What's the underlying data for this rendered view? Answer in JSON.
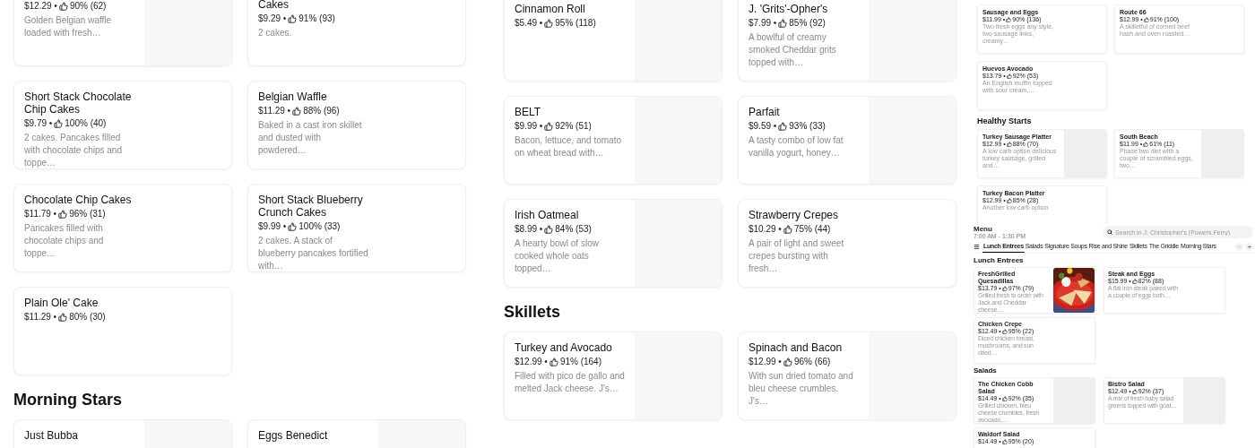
{
  "left_column": {
    "sections": [
      {
        "items": [
          {
            "kind": "with_image",
            "price": "$12.29 •",
            "rating": "90% (62)",
            "description": "Golden Belgian waffle loaded with fresh…"
          },
          {
            "kind": "text_only",
            "title": "Cakes",
            "price": "$9.29 •",
            "rating": "91% (93)",
            "description": "2 cakes."
          },
          {
            "kind": "text_only",
            "title": "Short Stack Chocolate Chip Cakes",
            "price": "$9.79 •",
            "rating": "100% (40)",
            "description": "2 cakes. Pancakes filled with chocolate chips and toppe…"
          },
          {
            "kind": "text_only",
            "title": "Belgian Waffle",
            "price": "$11.29 •",
            "rating": "88% (96)",
            "description": "Baked in a cast iron skillet and dusted with powdered…"
          },
          {
            "kind": "text_only",
            "title": "Chocolate Chip Cakes",
            "price": "$11.79 •",
            "rating": "96% (31)",
            "description": "Pancakes filled with chocolate chips and toppe…"
          },
          {
            "kind": "text_only",
            "title": "Short Stack Blueberry Crunch Cakes",
            "price": "$9.99 •",
            "rating": "100% (33)",
            "description": "2 cakes. A stack of blueberry pancakes fortified with…"
          },
          {
            "kind": "text_only",
            "title": "Plain Ole' Cake",
            "price": "$11.29 •",
            "rating": "80% (30)"
          }
        ]
      },
      {
        "heading": "Morning Stars",
        "items": [
          {
            "kind": "with_image",
            "title": "Just Bubba"
          },
          {
            "kind": "with_image",
            "title": "Eggs Benedict"
          }
        ]
      }
    ]
  },
  "middle_column": {
    "sections": [
      {
        "items": [
          {
            "kind": "with_image",
            "title": "Cinnamon Roll",
            "price": "$5.49 •",
            "rating": "95% (118)"
          },
          {
            "kind": "with_image",
            "title": "J. 'Grits'-Opher's",
            "price": "$7.99 •",
            "rating": "85% (92)",
            "description": "A bowlful of creamy smoked Cheddar grits topped with…"
          },
          {
            "kind": "with_image",
            "title": "BELT",
            "price": "$9.99 •",
            "rating": "92% (51)",
            "description": "Bacon, lettuce, and tomato on wheat bread with…"
          },
          {
            "kind": "with_image",
            "title": "Parfait",
            "price": "$9.59 •",
            "rating": "93% (33)",
            "description": "A tasty combo of low fat vanilla yogurt, honey…"
          },
          {
            "kind": "with_image",
            "title": "Irish Oatmeal",
            "price": "$8.99 •",
            "rating": "84% (53)",
            "description": "A hearty bowl of slow cooked whole oats topped…"
          },
          {
            "kind": "text_only",
            "title": "Strawberry Crepes",
            "price": "$10.29 •",
            "rating": "75% (44)",
            "description": "A pair of light and sweet crepes bursting with fresh…"
          }
        ]
      },
      {
        "heading": "Skillets",
        "items": [
          {
            "kind": "with_image",
            "title": "Turkey and Avocado",
            "price": "$12.99 •",
            "rating": "91% (164)",
            "description": "Filled with pico de gallo and melted Jack cheese. J's…"
          },
          {
            "kind": "with_image",
            "title": "Spinach and Bacon",
            "price": "$12.99 •",
            "rating": "96% (66)",
            "description": "With sun dried tomato and bleu cheese crumbles. J's…"
          }
        ]
      }
    ]
  },
  "right_column": {
    "top_view": {
      "sections": [
        {
          "items": [
            {
              "kind": "text_only",
              "title": "Sausage and Eggs",
              "price": "$11.99 •",
              "rating": "90% (136)",
              "description": "Two fresh eggs any style, two sausage links, creamy…"
            },
            {
              "kind": "text_only",
              "title": "Route 66",
              "price": "$12.99 •",
              "rating": "91% (100)",
              "description": "A skilletful of corned beef hash and oven roasted…"
            },
            {
              "kind": "text_only",
              "title": "Huevos Avocado",
              "price": "$13.79 •",
              "rating": "92% (53)",
              "description": "An English muffin topped with sour cream,…"
            }
          ]
        },
        {
          "heading": "Healthy Starts",
          "items": [
            {
              "kind": "with_image",
              "title": "Turkey Sausage Platter",
              "price": "$12.99 •",
              "rating": "88% (70)",
              "description": "A low carb option delicious turkey sausage, grilled and…"
            },
            {
              "kind": "with_image",
              "title": "South Beach",
              "price": "$11.99 •",
              "rating": "61% (11)",
              "description": "Phase two diet with a couple of scrambled eggs, two…"
            },
            {
              "kind": "text_only",
              "title": "Turkey Bacon Platter",
              "price": "$12.99 •",
              "rating": "85% (28)",
              "description": "Another low carb option"
            }
          ]
        }
      ]
    },
    "bottom_view": {
      "title": "Menu",
      "hours": "7:00 AM - 1:30 PM",
      "search": {
        "placeholder": "Search in J. Christopher's (Powers Ferry)"
      },
      "tabs": [
        {
          "label": "Lunch Entrees",
          "selected": true
        },
        {
          "label": "Salads",
          "selected": false
        },
        {
          "label": "Signature Soups",
          "selected": false
        },
        {
          "label": "Rise and Shine",
          "selected": false
        },
        {
          "label": "Skillets",
          "selected": false
        },
        {
          "label": "The Griddle",
          "selected": false
        },
        {
          "label": "Morning Stars",
          "selected": false
        }
      ],
      "sections": [
        {
          "heading": "Lunch Entrees",
          "items": [
            {
              "kind": "with_photo",
              "title": "FreshGrilled Quesadillas",
              "price": "$13.79 •",
              "rating": "97% (79)",
              "description": "Grilled fresh to order with Jack and Cheddar cheese…"
            },
            {
              "kind": "text_only",
              "title": "Steak and Eggs",
              "price": "$15.99 •",
              "rating": "82% (88)",
              "description": "A flat iron steak paired with a couple of eggs both…"
            },
            {
              "kind": "text_only",
              "title": "Chicken Crepe",
              "price": "$12.49 •",
              "rating": "95% (22)",
              "description": "Diced chicken breast, mushrooms, and sun dried…"
            }
          ]
        },
        {
          "heading": "Salads",
          "items": [
            {
              "kind": "with_image",
              "title": "The Chicken Cobb Salad",
              "price": "$14.49 •",
              "rating": "92% (35)",
              "description": "Grilled chicken, bleu cheese crumbles, fresh avocado,…"
            },
            {
              "kind": "with_image",
              "title": "Bistro Salad",
              "price": "$12.49 •",
              "rating": "92% (37)",
              "description": "A mix of fresh baby salad greens topped with goat…"
            },
            {
              "kind": "text_only",
              "title": "Waldorf Salad",
              "price": "$14.49 •",
              "rating": "95% (20)"
            }
          ]
        }
      ]
    }
  }
}
